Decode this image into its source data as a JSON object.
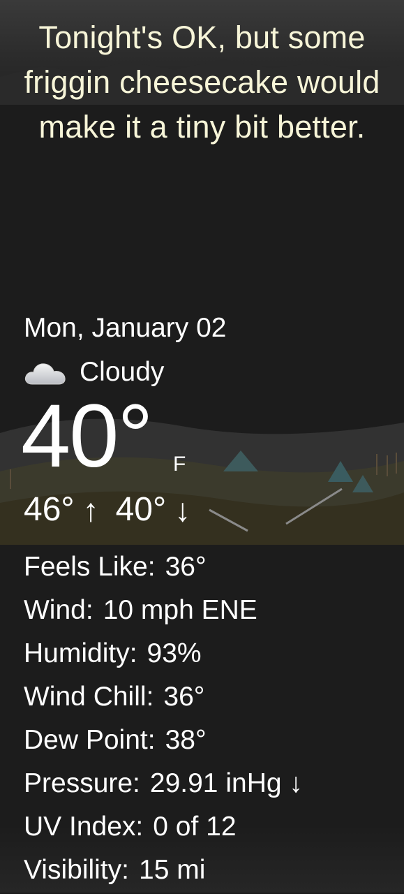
{
  "headline": "Tonight's OK, but some friggin cheesecake would make it a tiny bit better.",
  "date": "Mon, January 02",
  "condition": {
    "icon": "cloud-icon",
    "text": "Cloudy"
  },
  "temperature": {
    "current": "40°",
    "unit": "F",
    "high": "46°",
    "high_arrow": "↑",
    "low": "40°",
    "low_arrow": "↓"
  },
  "details": [
    {
      "label": "Feels Like:",
      "value": "36°"
    },
    {
      "label": "Wind:",
      "value": "10 mph ENE"
    },
    {
      "label": "Humidity:",
      "value": "93%"
    },
    {
      "label": "Wind Chill:",
      "value": "36°"
    },
    {
      "label": "Dew Point:",
      "value": "38°"
    },
    {
      "label": "Pressure:",
      "value": "29.91 inHg ↓"
    },
    {
      "label": "UV Index:",
      "value": "0 of 12"
    },
    {
      "label": "Visibility:",
      "value": "15 mi"
    }
  ],
  "colors": {
    "background": "#1c1c1c",
    "headline_text": "#f7f5d8",
    "text": "#ffffff"
  }
}
